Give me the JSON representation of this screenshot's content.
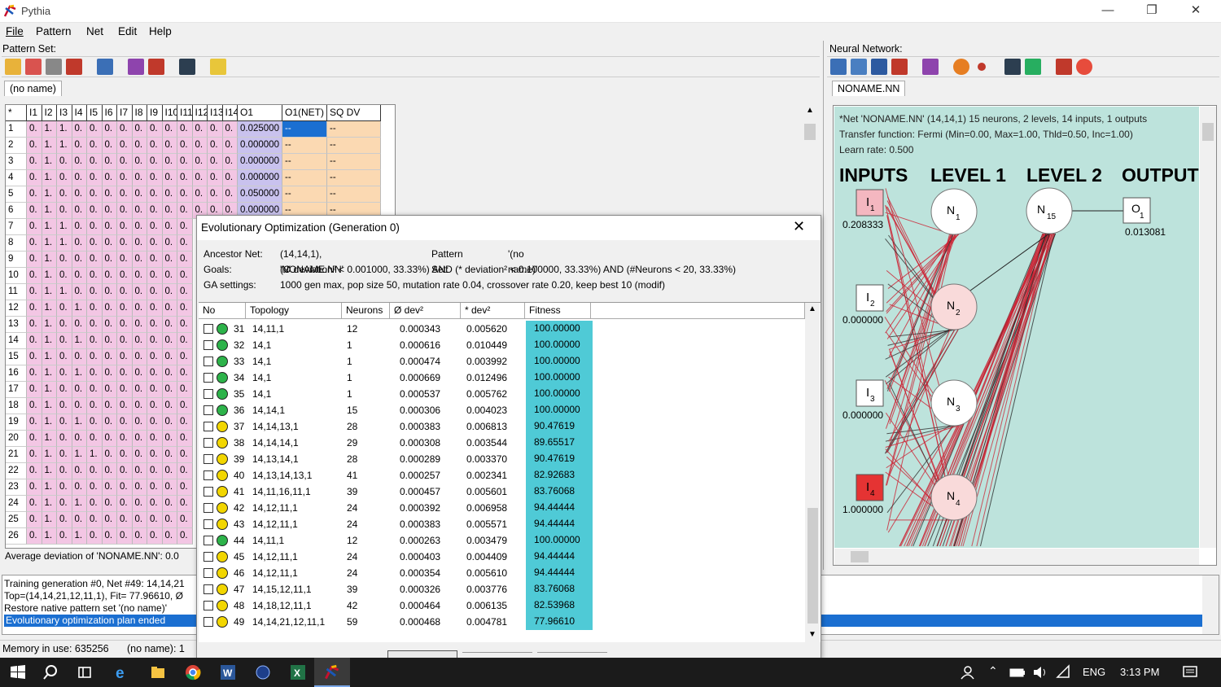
{
  "app": {
    "title": "Pythia"
  },
  "menu": [
    "File",
    "Pattern",
    "Net",
    "Edit",
    "Help"
  ],
  "pattern_panel": {
    "label": "Pattern Set:",
    "tab": "(no name)",
    "columns": [
      "",
      "I1",
      "I2",
      "I3",
      "I4",
      "I5",
      "I6",
      "I7",
      "I8",
      "I9",
      "I10",
      "I11",
      "I12",
      "I13",
      "I14",
      "O1",
      "O1(NET)",
      "SQ DV"
    ],
    "corner": "*",
    "rows": [
      {
        "n": "1",
        "v": [
          "0.",
          "1.",
          "1.",
          "0.",
          "0.",
          "0.",
          "0.",
          "0.",
          "0.",
          "0.",
          "0.",
          "0.",
          "0.",
          "0."
        ],
        "o": "0.025000"
      },
      {
        "n": "2",
        "v": [
          "0.",
          "1.",
          "1.",
          "0.",
          "0.",
          "0.",
          "0.",
          "0.",
          "0.",
          "0.",
          "0.",
          "0.",
          "0.",
          "0."
        ],
        "o": "0.000000"
      },
      {
        "n": "3",
        "v": [
          "0.",
          "1.",
          "0.",
          "0.",
          "0.",
          "0.",
          "0.",
          "0.",
          "0.",
          "0.",
          "0.",
          "0.",
          "0.",
          "0."
        ],
        "o": "0.000000"
      },
      {
        "n": "4",
        "v": [
          "0.",
          "1.",
          "0.",
          "0.",
          "0.",
          "0.",
          "0.",
          "0.",
          "0.",
          "0.",
          "0.",
          "0.",
          "0.",
          "0."
        ],
        "o": "0.000000"
      },
      {
        "n": "5",
        "v": [
          "0.",
          "1.",
          "0.",
          "0.",
          "0.",
          "0.",
          "0.",
          "0.",
          "0.",
          "0.",
          "0.",
          "0.",
          "0.",
          "0."
        ],
        "o": "0.050000"
      },
      {
        "n": "6",
        "v": [
          "0.",
          "1.",
          "0.",
          "0.",
          "0.",
          "0.",
          "0.",
          "0.",
          "0.",
          "0.",
          "0.",
          "0.",
          "0.",
          "0."
        ],
        "o": "0.000000"
      },
      {
        "n": "7",
        "v": [
          "0.",
          "1.",
          "1.",
          "0.",
          "0.",
          "0.",
          "0.",
          "0.",
          "0.",
          "0.",
          "0."
        ],
        "o": ""
      },
      {
        "n": "8",
        "v": [
          "0.",
          "1.",
          "1.",
          "0.",
          "0.",
          "0.",
          "0.",
          "0.",
          "0.",
          "0.",
          "0."
        ],
        "o": ""
      },
      {
        "n": "9",
        "v": [
          "0.",
          "1.",
          "0.",
          "0.",
          "0.",
          "0.",
          "0.",
          "0.",
          "0.",
          "0.",
          "0."
        ],
        "o": ""
      },
      {
        "n": "10",
        "v": [
          "0.",
          "1.",
          "0.",
          "0.",
          "0.",
          "0.",
          "0.",
          "0.",
          "0.",
          "0.",
          "0."
        ],
        "o": ""
      },
      {
        "n": "11",
        "v": [
          "0.",
          "1.",
          "1.",
          "0.",
          "0.",
          "0.",
          "0.",
          "0.",
          "0.",
          "0.",
          "0."
        ],
        "o": ""
      },
      {
        "n": "12",
        "v": [
          "0.",
          "1.",
          "0.",
          "1.",
          "0.",
          "0.",
          "0.",
          "0.",
          "0.",
          "0.",
          "0."
        ],
        "o": ""
      },
      {
        "n": "13",
        "v": [
          "0.",
          "1.",
          "0.",
          "0.",
          "0.",
          "0.",
          "0.",
          "0.",
          "0.",
          "0.",
          "0."
        ],
        "o": ""
      },
      {
        "n": "14",
        "v": [
          "0.",
          "1.",
          "0.",
          "1.",
          "0.",
          "0.",
          "0.",
          "0.",
          "0.",
          "0.",
          "0."
        ],
        "o": ""
      },
      {
        "n": "15",
        "v": [
          "0.",
          "1.",
          "0.",
          "0.",
          "0.",
          "0.",
          "0.",
          "0.",
          "0.",
          "0.",
          "0."
        ],
        "o": ""
      },
      {
        "n": "16",
        "v": [
          "0.",
          "1.",
          "0.",
          "1.",
          "0.",
          "0.",
          "0.",
          "0.",
          "0.",
          "0.",
          "0."
        ],
        "o": ""
      },
      {
        "n": "17",
        "v": [
          "0.",
          "1.",
          "0.",
          "0.",
          "0.",
          "0.",
          "0.",
          "0.",
          "0.",
          "0.",
          "0."
        ],
        "o": ""
      },
      {
        "n": "18",
        "v": [
          "0.",
          "1.",
          "0.",
          "0.",
          "0.",
          "0.",
          "0.",
          "0.",
          "0.",
          "0.",
          "0."
        ],
        "o": ""
      },
      {
        "n": "19",
        "v": [
          "0.",
          "1.",
          "0.",
          "1.",
          "0.",
          "0.",
          "0.",
          "0.",
          "0.",
          "0.",
          "0."
        ],
        "o": ""
      },
      {
        "n": "20",
        "v": [
          "0.",
          "1.",
          "0.",
          "0.",
          "0.",
          "0.",
          "0.",
          "0.",
          "0.",
          "0.",
          "0."
        ],
        "o": ""
      },
      {
        "n": "21",
        "v": [
          "0.",
          "1.",
          "0.",
          "1.",
          "1.",
          "0.",
          "0.",
          "0.",
          "0.",
          "0.",
          "0."
        ],
        "o": ""
      },
      {
        "n": "22",
        "v": [
          "0.",
          "1.",
          "0.",
          "0.",
          "0.",
          "0.",
          "0.",
          "0.",
          "0.",
          "0.",
          "0."
        ],
        "o": ""
      },
      {
        "n": "23",
        "v": [
          "0.",
          "1.",
          "0.",
          "0.",
          "0.",
          "0.",
          "0.",
          "0.",
          "0.",
          "0.",
          "0."
        ],
        "o": ""
      },
      {
        "n": "24",
        "v": [
          "0.",
          "1.",
          "0.",
          "1.",
          "0.",
          "0.",
          "0.",
          "0.",
          "0.",
          "0.",
          "0."
        ],
        "o": ""
      },
      {
        "n": "25",
        "v": [
          "0.",
          "1.",
          "0.",
          "0.",
          "0.",
          "0.",
          "0.",
          "0.",
          "0.",
          "0.",
          "0."
        ],
        "o": ""
      },
      {
        "n": "26",
        "v": [
          "0.",
          "1.",
          "0.",
          "1.",
          "0.",
          "0.",
          "0.",
          "0.",
          "0.",
          "0.",
          "0."
        ],
        "o": ""
      }
    ],
    "net_placeholder": "--",
    "avg_dev": "Average deviation of 'NONAME.NN': 0.0"
  },
  "log": {
    "lines": [
      "Training generation #0, Net #49: 14,14,21",
      "Top=(14,14,21,12,11,1), Fit= 77.96610, Ø",
      "Restore native pattern set '(no name)'",
      "Evolutionary optimization plan ended"
    ]
  },
  "status": {
    "memory": "Memory in use: 635256",
    "pattern": "(no name): 1"
  },
  "network_panel": {
    "label": "Neural Network:",
    "tab": "NONAME.NN",
    "info": [
      "*Net 'NONAME.NN' (14,14,1) 15 neurons, 2 levels, 14 inputs, 1 outputs",
      "Transfer function: Fermi (Min=0.00, Max=1.00, Thld=0.50, Inc=1.00)",
      "Learn rate: 0.500"
    ],
    "headers": [
      "INPUTS",
      "LEVEL 1",
      "LEVEL 2",
      "OUTPUT"
    ],
    "inputs": [
      {
        "label": "I",
        "sub": "1",
        "value": "0.208333"
      },
      {
        "label": "I",
        "sub": "2",
        "value": "0.000000"
      },
      {
        "label": "I",
        "sub": "3",
        "value": "0.000000"
      },
      {
        "label": "I",
        "sub": "4",
        "value": "1.000000"
      }
    ],
    "level1": [
      {
        "label": "N",
        "sub": "1"
      },
      {
        "label": "N",
        "sub": "2"
      },
      {
        "label": "N",
        "sub": "3"
      },
      {
        "label": "N",
        "sub": "4"
      }
    ],
    "level2": {
      "label": "N",
      "sub": "15"
    },
    "output": {
      "label": "O",
      "sub": "1",
      "value": "0.013081"
    }
  },
  "evo": {
    "title": "Evolutionary Optimization (Generation 0)",
    "ancestor_label": "Ancestor Net:",
    "ancestor_value": "(14,14,1), 'NONAME.NN'",
    "pattern_label": "Pattern Set:",
    "pattern_value": "'(no name)'",
    "goals_label": "Goals:",
    "goals_value": "(Ø deviation² <  0.001000, 33.33%)   AND   (* deviation² <  0.100000, 33.33%)   AND   (#Neurons < 20, 33.33%)",
    "ga_label": "GA settings:",
    "ga_value": "1000 gen max, pop size 50, mutation rate 0.04, crossover rate 0.20, keep best 10 (modif)",
    "columns": [
      "No",
      "Topology",
      "Neurons",
      "Ø dev²",
      "* dev²",
      "Fitness"
    ],
    "rows": [
      {
        "no": "31",
        "top": "14,11,1",
        "neu": "12",
        "d1": "0.000343",
        "d2": "0.005620",
        "fit": "100.00000",
        "c": "green"
      },
      {
        "no": "32",
        "top": "14,1",
        "neu": "1",
        "d1": "0.000616",
        "d2": "0.010449",
        "fit": "100.00000",
        "c": "green"
      },
      {
        "no": "33",
        "top": "14,1",
        "neu": "1",
        "d1": "0.000474",
        "d2": "0.003992",
        "fit": "100.00000",
        "c": "green"
      },
      {
        "no": "34",
        "top": "14,1",
        "neu": "1",
        "d1": "0.000669",
        "d2": "0.012496",
        "fit": "100.00000",
        "c": "green"
      },
      {
        "no": "35",
        "top": "14,1",
        "neu": "1",
        "d1": "0.000537",
        "d2": "0.005762",
        "fit": "100.00000",
        "c": "green"
      },
      {
        "no": "36",
        "top": "14,14,1",
        "neu": "15",
        "d1": "0.000306",
        "d2": "0.004023",
        "fit": "100.00000",
        "c": "green"
      },
      {
        "no": "37",
        "top": "14,14,13,1",
        "neu": "28",
        "d1": "0.000383",
        "d2": "0.006813",
        "fit": "90.47619",
        "c": "yellow"
      },
      {
        "no": "38",
        "top": "14,14,14,1",
        "neu": "29",
        "d1": "0.000308",
        "d2": "0.003544",
        "fit": "89.65517",
        "c": "yellow"
      },
      {
        "no": "39",
        "top": "14,13,14,1",
        "neu": "28",
        "d1": "0.000289",
        "d2": "0.003370",
        "fit": "90.47619",
        "c": "yellow"
      },
      {
        "no": "40",
        "top": "14,13,14,13,1",
        "neu": "41",
        "d1": "0.000257",
        "d2": "0.002341",
        "fit": "82.92683",
        "c": "yellow"
      },
      {
        "no": "41",
        "top": "14,11,16,11,1",
        "neu": "39",
        "d1": "0.000457",
        "d2": "0.005601",
        "fit": "83.76068",
        "c": "yellow"
      },
      {
        "no": "42",
        "top": "14,12,11,1",
        "neu": "24",
        "d1": "0.000392",
        "d2": "0.006958",
        "fit": "94.44444",
        "c": "yellow"
      },
      {
        "no": "43",
        "top": "14,12,11,1",
        "neu": "24",
        "d1": "0.000383",
        "d2": "0.005571",
        "fit": "94.44444",
        "c": "yellow"
      },
      {
        "no": "44",
        "top": "14,11,1",
        "neu": "12",
        "d1": "0.000263",
        "d2": "0.003479",
        "fit": "100.00000",
        "c": "green"
      },
      {
        "no": "45",
        "top": "14,12,11,1",
        "neu": "24",
        "d1": "0.000403",
        "d2": "0.004409",
        "fit": "94.44444",
        "c": "yellow"
      },
      {
        "no": "46",
        "top": "14,12,11,1",
        "neu": "24",
        "d1": "0.000354",
        "d2": "0.005610",
        "fit": "94.44444",
        "c": "yellow"
      },
      {
        "no": "47",
        "top": "14,15,12,11,1",
        "neu": "39",
        "d1": "0.000326",
        "d2": "0.003776",
        "fit": "83.76068",
        "c": "yellow"
      },
      {
        "no": "48",
        "top": "14,18,12,11,1",
        "neu": "42",
        "d1": "0.000464",
        "d2": "0.006135",
        "fit": "82.53968",
        "c": "yellow"
      },
      {
        "no": "49",
        "top": "14,14,21,12,11,1",
        "neu": "59",
        "d1": "0.000468",
        "d2": "0.004781",
        "fit": "77.96610",
        "c": "yellow"
      }
    ]
  },
  "taskbar": {
    "lang": "ENG",
    "time": "3:13 PM"
  },
  "colors": {
    "pink": "#f3c6e4",
    "lavender": "#c9c2ee",
    "peach": "#fbd9b2",
    "teal": "#bde3dc",
    "fitness": "#4fcad6",
    "select": "#1b6fd1"
  }
}
